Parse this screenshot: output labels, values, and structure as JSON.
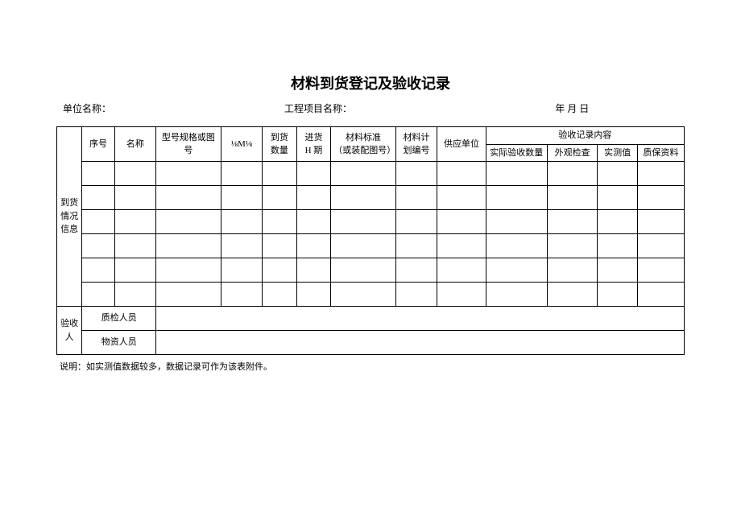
{
  "title": "材料到货登记及验收记录",
  "meta": {
    "unit_label": "单位名称：",
    "project_label": "工程项目名称：",
    "date_label": "年 月 日"
  },
  "side": {
    "arrival": "到货情况信息",
    "acceptor": "验收人"
  },
  "headers": {
    "seq": "序号",
    "name": "名称",
    "spec": "型号规格或图号",
    "unit": "⅛M⅛",
    "qty_top": "到货",
    "qty_bot": "数量",
    "date_top": "进货",
    "date_bot": "H 期",
    "std_top": "材料标准",
    "std_bot": "（或装配图号）",
    "plan_top": "材料计",
    "plan_bot": "划编号",
    "supplier": "供应单位",
    "accept_group": "验收记录内容",
    "a": "实际验收数量",
    "b": "外观检查",
    "c": "实测值",
    "d": "质保资料"
  },
  "rows": [
    {
      "seq": "",
      "name": "",
      "spec": "",
      "unit": "",
      "qty": "",
      "date": "",
      "std": "",
      "plan": "",
      "supplier": "",
      "a": "",
      "b": "",
      "c": "",
      "d": ""
    },
    {
      "seq": "",
      "name": "",
      "spec": "",
      "unit": "",
      "qty": "",
      "date": "",
      "std": "",
      "plan": "",
      "supplier": "",
      "a": "",
      "b": "",
      "c": "",
      "d": ""
    },
    {
      "seq": "",
      "name": "",
      "spec": "",
      "unit": "",
      "qty": "",
      "date": "",
      "std": "",
      "plan": "",
      "supplier": "",
      "a": "",
      "b": "",
      "c": "",
      "d": ""
    },
    {
      "seq": "",
      "name": "",
      "spec": "",
      "unit": "",
      "qty": "",
      "date": "",
      "std": "",
      "plan": "",
      "supplier": "",
      "a": "",
      "b": "",
      "c": "",
      "d": ""
    },
    {
      "seq": "",
      "name": "",
      "spec": "",
      "unit": "",
      "qty": "",
      "date": "",
      "std": "",
      "plan": "",
      "supplier": "",
      "a": "",
      "b": "",
      "c": "",
      "d": ""
    },
    {
      "seq": "",
      "name": "",
      "spec": "",
      "unit": "",
      "qty": "",
      "date": "",
      "std": "",
      "plan": "",
      "supplier": "",
      "a": "",
      "b": "",
      "c": "",
      "d": ""
    }
  ],
  "sign": {
    "qc": "质检人员",
    "mat": "物资人员"
  },
  "footnote": "说明：如实测值数据较多，数据记录可作为该表附件。"
}
